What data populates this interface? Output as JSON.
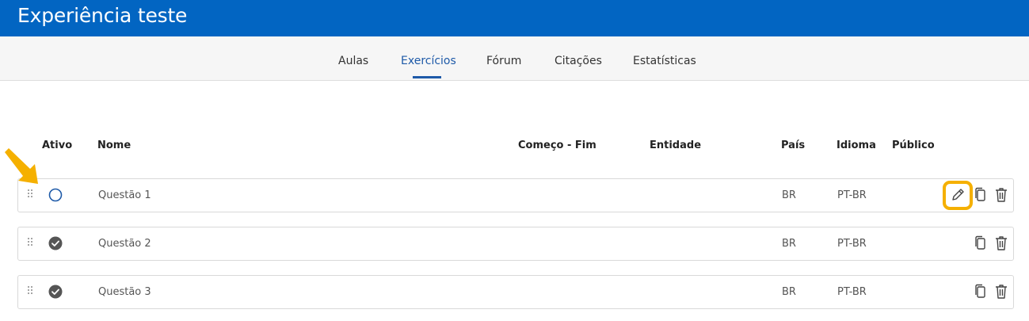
{
  "header": {
    "title": "Experiência teste"
  },
  "tabs": [
    {
      "label": "Aulas",
      "active": false
    },
    {
      "label": "Exercícios",
      "active": true
    },
    {
      "label": "Fórum",
      "active": false
    },
    {
      "label": "Citações",
      "active": false
    },
    {
      "label": "Estatísticas",
      "active": false
    }
  ],
  "table": {
    "columns": {
      "active": "Ativo",
      "name": "Nome",
      "dates": "Começo - Fim",
      "entity": "Entidade",
      "country": "País",
      "language": "Idioma",
      "audience": "Público"
    },
    "rows": [
      {
        "name": "Questão 1",
        "dates": "",
        "entity": "",
        "country": "BR",
        "language": "PT-BR",
        "audience": "",
        "status": "inactive",
        "editable": true
      },
      {
        "name": "Questão 2",
        "dates": "",
        "entity": "",
        "country": "BR",
        "language": "PT-BR",
        "audience": "",
        "status": "active",
        "editable": false
      },
      {
        "name": "Questão 3",
        "dates": "",
        "entity": "",
        "country": "BR",
        "language": "PT-BR",
        "audience": "",
        "status": "active",
        "editable": false
      }
    ]
  },
  "colors": {
    "header": "#0265c2",
    "activeTab": "#1e5aa8",
    "highlight": "#f5b000",
    "statusInactive": "#1e5aa8",
    "statusActive": "#555555"
  },
  "icons": {
    "drag": "drag-handle-icon",
    "status_inactive": "empty-circle-icon",
    "status_active": "check-circle-icon",
    "edit": "pencil-icon",
    "copy": "copy-icon",
    "delete": "trash-icon",
    "annotation": "arrow-icon"
  }
}
